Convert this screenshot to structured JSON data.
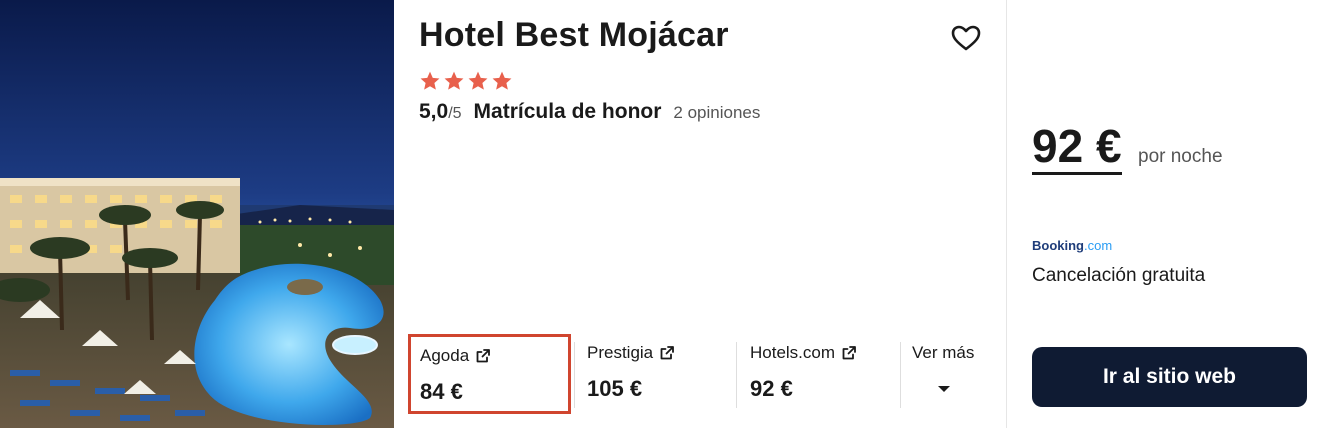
{
  "hotel": {
    "name": "Hotel Best Mojácar",
    "stars": 4,
    "score": "5,0",
    "scale": "/5",
    "rating_label": "Matrícula de honor",
    "reviews": "2 opiniones",
    "favorite_icon": "heart-icon"
  },
  "offers": [
    {
      "provider": "Agoda",
      "price": "84 €",
      "highlighted": true,
      "icon": "external-link-icon"
    },
    {
      "provider": "Prestigia",
      "price": "105 €",
      "highlighted": false,
      "icon": "external-link-icon"
    },
    {
      "provider": "Hotels.com",
      "price": "92 €",
      "highlighted": false,
      "icon": "external-link-icon"
    }
  ],
  "more": {
    "label": "Ver más",
    "icon": "caret-down-icon"
  },
  "deal": {
    "price": "92 €",
    "per_night": "por noche",
    "provider_logo_main": "Booking",
    "provider_logo_suffix": ".com",
    "cancellation": "Cancelación gratuita",
    "cta_label": "Ir al sitio web"
  },
  "colors": {
    "star": "#e8604c",
    "highlight_border": "#d0452f",
    "cta_bg": "#0f1b33",
    "booking_blue": "#1f3d7a",
    "booking_light": "#2a9df4"
  }
}
